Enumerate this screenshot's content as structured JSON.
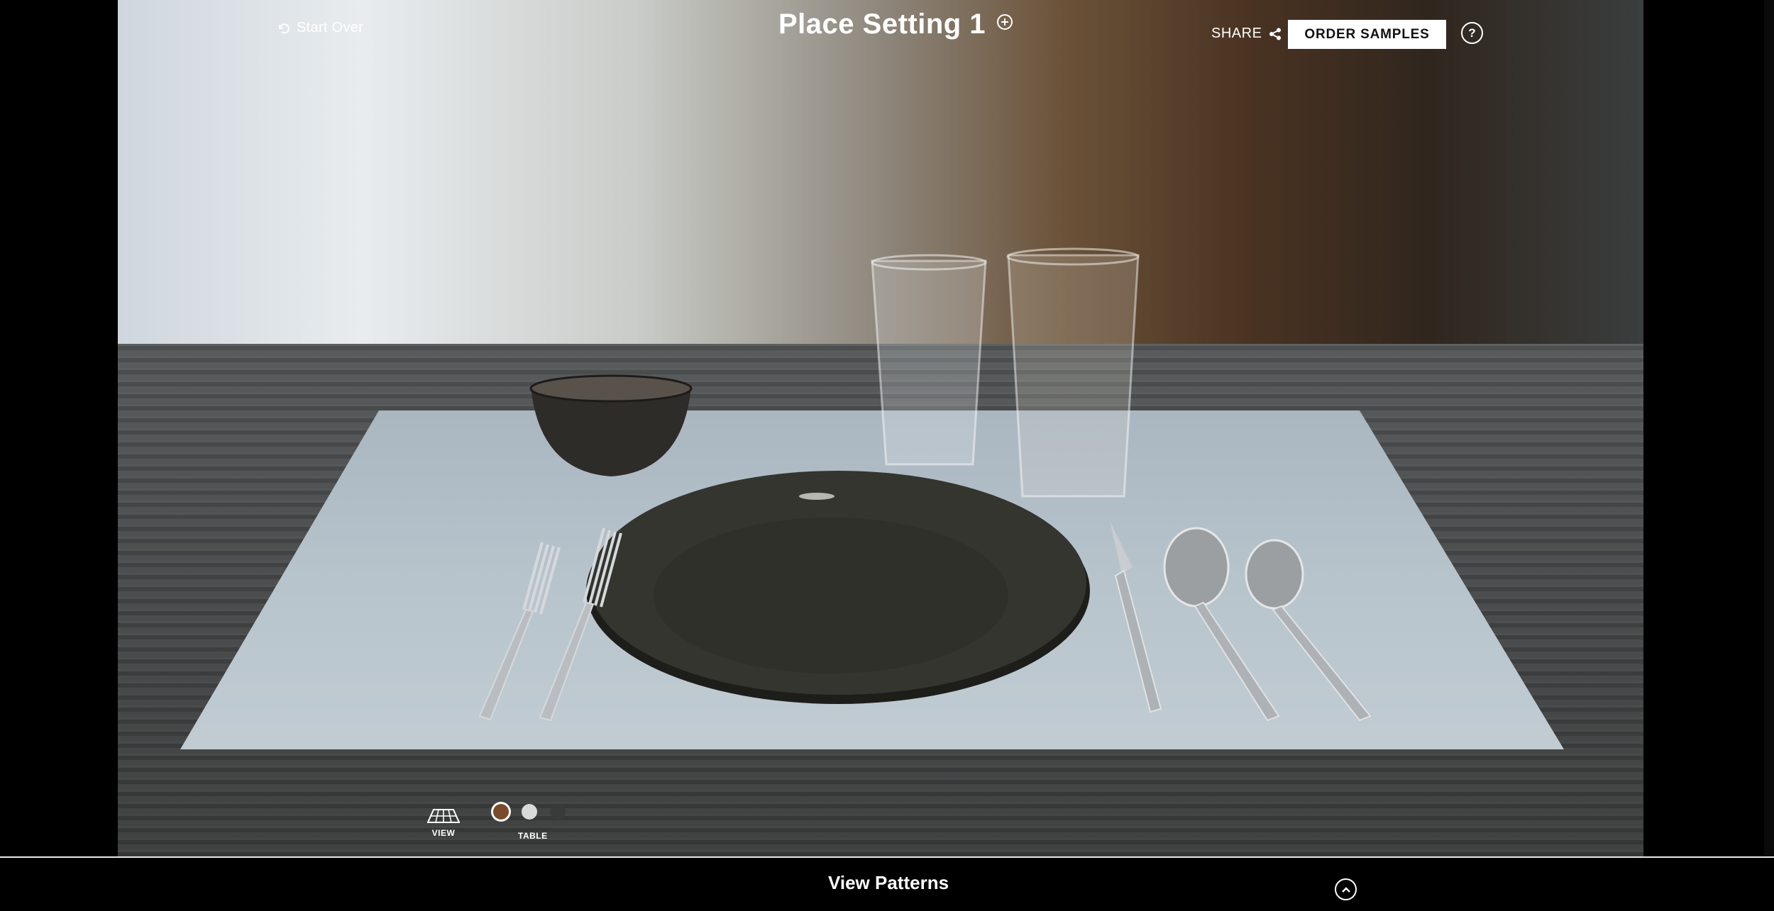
{
  "header": {
    "start_over_label": "Start Over",
    "title": "Place Setting 1",
    "share_label": "SHARE",
    "order_samples_label": "ORDER SAMPLES",
    "help_symbol": "?"
  },
  "controls": {
    "view_label": "VIEW",
    "table_label": "TABLE",
    "table_swatches": [
      {
        "name": "wood-brown",
        "color": "#7a4a2a",
        "selected": true
      },
      {
        "name": "light-gray",
        "color": "#d9d9d9",
        "selected": false
      },
      {
        "name": "dark-gray",
        "color": "#3a3a3a",
        "selected": false
      }
    ]
  },
  "footer": {
    "view_patterns_label": "View Patterns"
  },
  "icons": {
    "start_over": "undo-icon",
    "add_setting": "plus-circle-icon",
    "share": "share-icon",
    "help": "help-icon",
    "view": "table-perspective-icon",
    "expand": "chevron-up-icon"
  }
}
